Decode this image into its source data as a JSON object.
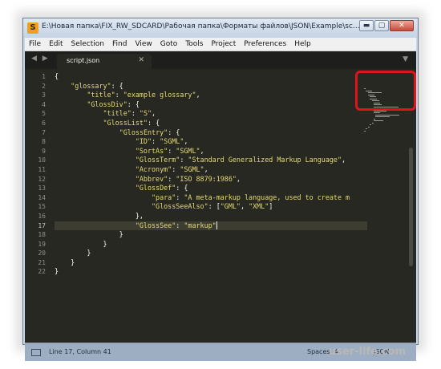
{
  "window": {
    "title": "E:\\Новая папка\\FIX_RW_SDCARD\\Рабочая папка\\Форматы файлов\\JSON\\Example\\script.json...",
    "minimize_label": "▬",
    "maximize_label": "▢",
    "close_label": "✕",
    "app_icon": "S"
  },
  "menu": [
    "File",
    "Edit",
    "Selection",
    "Find",
    "View",
    "Goto",
    "Tools",
    "Project",
    "Preferences",
    "Help"
  ],
  "tabs": {
    "nav_arrows": "◀ ▶",
    "active_tab": "script.json",
    "close_glyph": "✕",
    "dropdown_glyph": "▼"
  },
  "editor": {
    "active_line": 17,
    "lines": [
      [
        [
          "p",
          "{"
        ]
      ],
      [
        [
          "p",
          "    "
        ],
        [
          "s",
          "\"glossary\""
        ],
        [
          "p",
          ": {"
        ]
      ],
      [
        [
          "p",
          "        "
        ],
        [
          "s",
          "\"title\""
        ],
        [
          "p",
          ": "
        ],
        [
          "s",
          "\"example glossary\""
        ],
        [
          "p",
          ","
        ]
      ],
      [
        [
          "p",
          "        "
        ],
        [
          "s",
          "\"GlossDiv\""
        ],
        [
          "p",
          ": {"
        ]
      ],
      [
        [
          "p",
          "            "
        ],
        [
          "s",
          "\"title\""
        ],
        [
          "p",
          ": "
        ],
        [
          "s",
          "\"S\""
        ],
        [
          "p",
          ","
        ]
      ],
      [
        [
          "p",
          "            "
        ],
        [
          "s",
          "\"GlossList\""
        ],
        [
          "p",
          ": {"
        ]
      ],
      [
        [
          "p",
          "                "
        ],
        [
          "s",
          "\"GlossEntry\""
        ],
        [
          "p",
          ": {"
        ]
      ],
      [
        [
          "p",
          "                    "
        ],
        [
          "s",
          "\"ID\""
        ],
        [
          "p",
          ": "
        ],
        [
          "s",
          "\"SGML\""
        ],
        [
          "p",
          ","
        ]
      ],
      [
        [
          "p",
          "                    "
        ],
        [
          "s",
          "\"SortAs\""
        ],
        [
          "p",
          ": "
        ],
        [
          "s",
          "\"SGML\""
        ],
        [
          "p",
          ","
        ]
      ],
      [
        [
          "p",
          "                    "
        ],
        [
          "s",
          "\"GlossTerm\""
        ],
        [
          "p",
          ": "
        ],
        [
          "s",
          "\"Standard Generalized Markup Language\""
        ],
        [
          "p",
          ","
        ]
      ],
      [
        [
          "p",
          "                    "
        ],
        [
          "s",
          "\"Acronym\""
        ],
        [
          "p",
          ": "
        ],
        [
          "s",
          "\"SGML\""
        ],
        [
          "p",
          ","
        ]
      ],
      [
        [
          "p",
          "                    "
        ],
        [
          "s",
          "\"Abbrev\""
        ],
        [
          "p",
          ": "
        ],
        [
          "s",
          "\"ISO 8879:1986\""
        ],
        [
          "p",
          ","
        ]
      ],
      [
        [
          "p",
          "                    "
        ],
        [
          "s",
          "\"GlossDef\""
        ],
        [
          "p",
          ": {"
        ]
      ],
      [
        [
          "p",
          "                        "
        ],
        [
          "s",
          "\"para\""
        ],
        [
          "p",
          ": "
        ],
        [
          "s",
          "\"A meta-markup language, used to create m"
        ]
      ],
      [
        [
          "p",
          "                        "
        ],
        [
          "s",
          "\"GlossSeeAlso\""
        ],
        [
          "p",
          ": ["
        ],
        [
          "s",
          "\"GML\""
        ],
        [
          "p",
          ", "
        ],
        [
          "s",
          "\"XML\""
        ],
        [
          "p",
          "]"
        ]
      ],
      [
        [
          "p",
          "                    },"
        ]
      ],
      [
        [
          "p",
          "                    "
        ],
        [
          "s",
          "\"GlossSee\""
        ],
        [
          "p",
          ": "
        ],
        [
          "s",
          "\"markup\""
        ]
      ],
      [
        [
          "p",
          "                }"
        ]
      ],
      [
        [
          "p",
          "            }"
        ]
      ],
      [
        [
          "p",
          "        }"
        ]
      ],
      [
        [
          "p",
          "    }"
        ]
      ],
      [
        [
          "p",
          "}"
        ]
      ]
    ]
  },
  "status": {
    "position": "Line 17, Column 41",
    "spaces": "Spaces: 4",
    "syntax": "JSON"
  },
  "watermark": "user-life.com",
  "colors": {
    "editor_bg": "#272822",
    "string": "#e6db74",
    "text": "#f8f8f2",
    "annotation": "#e0141c"
  }
}
